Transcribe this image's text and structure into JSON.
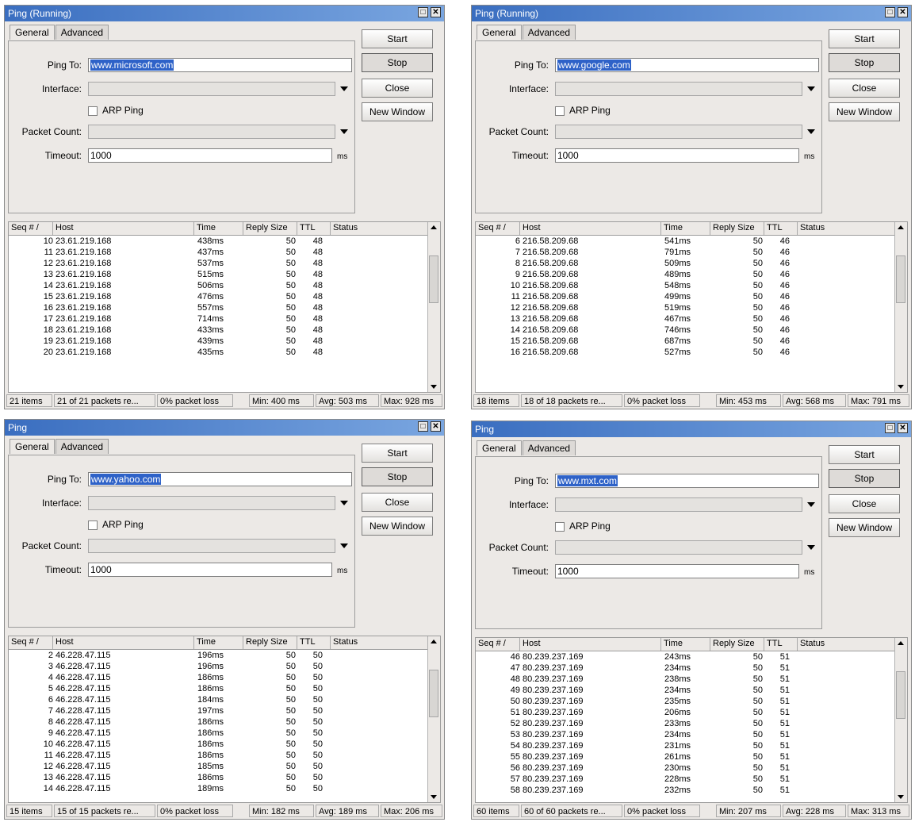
{
  "labels": {
    "tab_general": "General",
    "tab_advanced": "Advanced",
    "ping_to": "Ping To:",
    "interface": "Interface:",
    "arp_ping": "ARP Ping",
    "packet_count": "Packet Count:",
    "timeout": "Timeout:",
    "timeout_unit": "ms",
    "start": "Start",
    "stop": "Stop",
    "close": "Close",
    "new_window": "New Window",
    "col_seq": "Seq # /",
    "col_host": "Host",
    "col_time": "Time",
    "col_reply_size": "Reply Size",
    "col_ttl": "TTL",
    "col_status": "Status",
    "max_glyph": "□",
    "close_glyph": "✕"
  },
  "windows": [
    {
      "title": "Ping (Running)",
      "ping_to": "www.microsoft.com",
      "interface": "",
      "packet_count": "",
      "timeout": "1000",
      "rows": [
        {
          "seq": "10",
          "host": "23.61.219.168",
          "time": "438ms",
          "reply_size": "50",
          "ttl": "48"
        },
        {
          "seq": "11",
          "host": "23.61.219.168",
          "time": "437ms",
          "reply_size": "50",
          "ttl": "48"
        },
        {
          "seq": "12",
          "host": "23.61.219.168",
          "time": "537ms",
          "reply_size": "50",
          "ttl": "48"
        },
        {
          "seq": "13",
          "host": "23.61.219.168",
          "time": "515ms",
          "reply_size": "50",
          "ttl": "48"
        },
        {
          "seq": "14",
          "host": "23.61.219.168",
          "time": "506ms",
          "reply_size": "50",
          "ttl": "48"
        },
        {
          "seq": "15",
          "host": "23.61.219.168",
          "time": "476ms",
          "reply_size": "50",
          "ttl": "48"
        },
        {
          "seq": "16",
          "host": "23.61.219.168",
          "time": "557ms",
          "reply_size": "50",
          "ttl": "48"
        },
        {
          "seq": "17",
          "host": "23.61.219.168",
          "time": "714ms",
          "reply_size": "50",
          "ttl": "48"
        },
        {
          "seq": "18",
          "host": "23.61.219.168",
          "time": "433ms",
          "reply_size": "50",
          "ttl": "48"
        },
        {
          "seq": "19",
          "host": "23.61.219.168",
          "time": "439ms",
          "reply_size": "50",
          "ttl": "48"
        },
        {
          "seq": "20",
          "host": "23.61.219.168",
          "time": "435ms",
          "reply_size": "50",
          "ttl": "48"
        }
      ],
      "status": {
        "items": "21 items",
        "packets": "21 of 21 packets re...",
        "loss": "0% packet loss",
        "min": "Min: 400 ms",
        "avg": "Avg: 503 ms",
        "max": "Max: 928 ms"
      }
    },
    {
      "title": "Ping (Running)",
      "ping_to": "www.google.com",
      "interface": "",
      "packet_count": "",
      "timeout": "1000",
      "rows": [
        {
          "seq": "6",
          "host": "216.58.209.68",
          "time": "541ms",
          "reply_size": "50",
          "ttl": "46"
        },
        {
          "seq": "7",
          "host": "216.58.209.68",
          "time": "791ms",
          "reply_size": "50",
          "ttl": "46"
        },
        {
          "seq": "8",
          "host": "216.58.209.68",
          "time": "509ms",
          "reply_size": "50",
          "ttl": "46"
        },
        {
          "seq": "9",
          "host": "216.58.209.68",
          "time": "489ms",
          "reply_size": "50",
          "ttl": "46"
        },
        {
          "seq": "10",
          "host": "216.58.209.68",
          "time": "548ms",
          "reply_size": "50",
          "ttl": "46"
        },
        {
          "seq": "11",
          "host": "216.58.209.68",
          "time": "499ms",
          "reply_size": "50",
          "ttl": "46"
        },
        {
          "seq": "12",
          "host": "216.58.209.68",
          "time": "519ms",
          "reply_size": "50",
          "ttl": "46"
        },
        {
          "seq": "13",
          "host": "216.58.209.68",
          "time": "467ms",
          "reply_size": "50",
          "ttl": "46"
        },
        {
          "seq": "14",
          "host": "216.58.209.68",
          "time": "746ms",
          "reply_size": "50",
          "ttl": "46"
        },
        {
          "seq": "15",
          "host": "216.58.209.68",
          "time": "687ms",
          "reply_size": "50",
          "ttl": "46"
        },
        {
          "seq": "16",
          "host": "216.58.209.68",
          "time": "527ms",
          "reply_size": "50",
          "ttl": "46"
        }
      ],
      "status": {
        "items": "18 items",
        "packets": "18 of 18 packets re...",
        "loss": "0% packet loss",
        "min": "Min: 453 ms",
        "avg": "Avg: 568 ms",
        "max": "Max: 791 ms"
      }
    },
    {
      "title": "Ping",
      "ping_to": "www.yahoo.com",
      "interface": "",
      "packet_count": "",
      "timeout": "1000",
      "rows": [
        {
          "seq": "2",
          "host": "46.228.47.115",
          "time": "196ms",
          "reply_size": "50",
          "ttl": "50"
        },
        {
          "seq": "3",
          "host": "46.228.47.115",
          "time": "196ms",
          "reply_size": "50",
          "ttl": "50"
        },
        {
          "seq": "4",
          "host": "46.228.47.115",
          "time": "186ms",
          "reply_size": "50",
          "ttl": "50"
        },
        {
          "seq": "5",
          "host": "46.228.47.115",
          "time": "186ms",
          "reply_size": "50",
          "ttl": "50"
        },
        {
          "seq": "6",
          "host": "46.228.47.115",
          "time": "184ms",
          "reply_size": "50",
          "ttl": "50"
        },
        {
          "seq": "7",
          "host": "46.228.47.115",
          "time": "197ms",
          "reply_size": "50",
          "ttl": "50"
        },
        {
          "seq": "8",
          "host": "46.228.47.115",
          "time": "186ms",
          "reply_size": "50",
          "ttl": "50"
        },
        {
          "seq": "9",
          "host": "46.228.47.115",
          "time": "186ms",
          "reply_size": "50",
          "ttl": "50"
        },
        {
          "seq": "10",
          "host": "46.228.47.115",
          "time": "186ms",
          "reply_size": "50",
          "ttl": "50"
        },
        {
          "seq": "11",
          "host": "46.228.47.115",
          "time": "186ms",
          "reply_size": "50",
          "ttl": "50"
        },
        {
          "seq": "12",
          "host": "46.228.47.115",
          "time": "185ms",
          "reply_size": "50",
          "ttl": "50"
        },
        {
          "seq": "13",
          "host": "46.228.47.115",
          "time": "186ms",
          "reply_size": "50",
          "ttl": "50"
        },
        {
          "seq": "14",
          "host": "46.228.47.115",
          "time": "189ms",
          "reply_size": "50",
          "ttl": "50"
        }
      ],
      "status": {
        "items": "15 items",
        "packets": "15 of 15 packets re...",
        "loss": "0% packet loss",
        "min": "Min: 182 ms",
        "avg": "Avg: 189 ms",
        "max": "Max: 206 ms"
      }
    },
    {
      "title": "Ping",
      "ping_to": "www.mxt.com",
      "interface": "",
      "packet_count": "",
      "timeout": "1000",
      "rows": [
        {
          "seq": "46",
          "host": "80.239.237.169",
          "time": "243ms",
          "reply_size": "50",
          "ttl": "51"
        },
        {
          "seq": "47",
          "host": "80.239.237.169",
          "time": "234ms",
          "reply_size": "50",
          "ttl": "51"
        },
        {
          "seq": "48",
          "host": "80.239.237.169",
          "time": "238ms",
          "reply_size": "50",
          "ttl": "51"
        },
        {
          "seq": "49",
          "host": "80.239.237.169",
          "time": "234ms",
          "reply_size": "50",
          "ttl": "51"
        },
        {
          "seq": "50",
          "host": "80.239.237.169",
          "time": "235ms",
          "reply_size": "50",
          "ttl": "51"
        },
        {
          "seq": "51",
          "host": "80.239.237.169",
          "time": "206ms",
          "reply_size": "50",
          "ttl": "51"
        },
        {
          "seq": "52",
          "host": "80.239.237.169",
          "time": "233ms",
          "reply_size": "50",
          "ttl": "51"
        },
        {
          "seq": "53",
          "host": "80.239.237.169",
          "time": "234ms",
          "reply_size": "50",
          "ttl": "51"
        },
        {
          "seq": "54",
          "host": "80.239.237.169",
          "time": "231ms",
          "reply_size": "50",
          "ttl": "51"
        },
        {
          "seq": "55",
          "host": "80.239.237.169",
          "time": "261ms",
          "reply_size": "50",
          "ttl": "51"
        },
        {
          "seq": "56",
          "host": "80.239.237.169",
          "time": "230ms",
          "reply_size": "50",
          "ttl": "51"
        },
        {
          "seq": "57",
          "host": "80.239.237.169",
          "time": "228ms",
          "reply_size": "50",
          "ttl": "51"
        },
        {
          "seq": "58",
          "host": "80.239.237.169",
          "time": "232ms",
          "reply_size": "50",
          "ttl": "51"
        }
      ],
      "status": {
        "items": "60 items",
        "packets": "60 of 60 packets re...",
        "loss": "0% packet loss",
        "min": "Min: 207 ms",
        "avg": "Avg: 228 ms",
        "max": "Max: 313 ms"
      }
    }
  ]
}
